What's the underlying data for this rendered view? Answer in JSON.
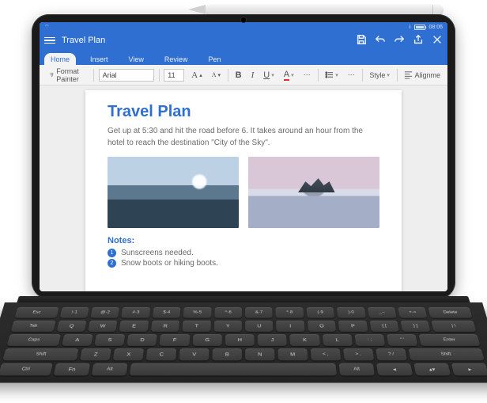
{
  "status": {
    "time": "08:06",
    "wifi": "wifi-icon",
    "bt": "bt-icon"
  },
  "app": {
    "title": "Travel Plan",
    "actions": {
      "save": "save",
      "undo": "undo",
      "redo": "redo",
      "share": "share",
      "close": "close"
    }
  },
  "menu": {
    "tabs": [
      "Home",
      "Insert",
      "View",
      "Review",
      "Pen"
    ],
    "active": 0
  },
  "ribbon": {
    "format_painter": "Format Painter",
    "font_name": "Arial",
    "font_size": "11",
    "style_label": "Style",
    "align_label": "Alignme"
  },
  "doc": {
    "title": "Travel Plan",
    "body": "Get up at 5:30 and hit the road before 6. It takes around an hour from the hotel to reach the destination \"City of the Sky\".",
    "images": [
      "mountain-landscape",
      "lake-reflection"
    ],
    "notes_heading": "Notes:",
    "notes": [
      "Sunscreens needed.",
      "Snow boots or hiking boots."
    ]
  },
  "keyboard": {
    "row1": [
      "Esc",
      "!·1",
      "@·2",
      "#·3",
      "$·4",
      "%·5",
      "^·6",
      "&·7",
      "*·8",
      "(·9",
      ")·0",
      "_·-",
      "+·=",
      "Delete"
    ],
    "row2": [
      "Tab",
      "Q",
      "W",
      "E",
      "R",
      "T",
      "Y",
      "U",
      "I",
      "O",
      "P",
      "{ [",
      "} ]",
      "| \\"
    ],
    "row3": [
      "Caps",
      "A",
      "S",
      "D",
      "F",
      "G",
      "H",
      "J",
      "K",
      "L",
      ": ;",
      "\" '",
      "Enter"
    ],
    "row4": [
      "Shift",
      "Z",
      "X",
      "C",
      "V",
      "B",
      "N",
      "M",
      "< ,",
      "> .",
      "? /",
      "Shift"
    ],
    "row5": [
      "Ctrl",
      "Fn",
      "Alt",
      "",
      "Alt",
      "◂",
      "▴▾",
      "▸"
    ]
  }
}
